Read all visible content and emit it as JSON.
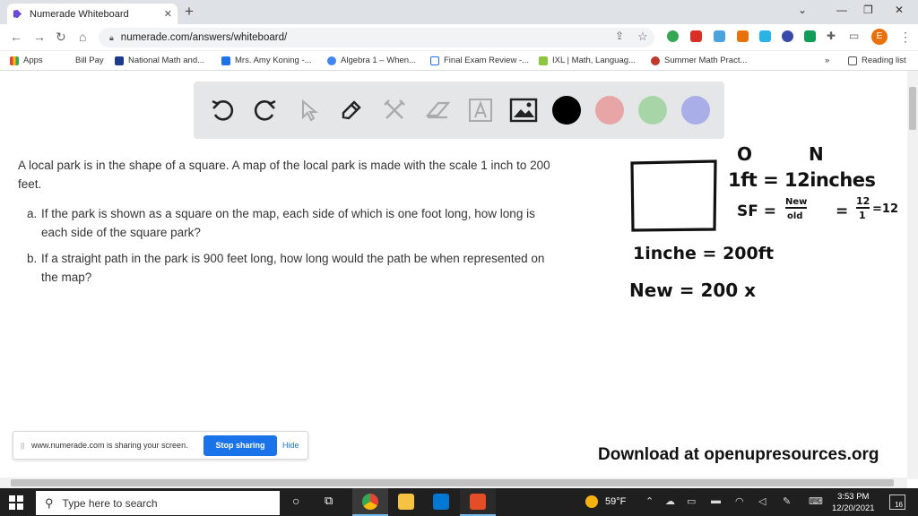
{
  "browser": {
    "tab_title": "Numerade Whiteboard",
    "url": "numerade.com/answers/whiteboard/",
    "profile_initial": "E"
  },
  "bookmarks": [
    {
      "label": "Apps"
    },
    {
      "label": "Bill Pay"
    },
    {
      "label": "National Math and..."
    },
    {
      "label": "Mrs. Amy Koning -..."
    },
    {
      "label": "Algebra 1 – When..."
    },
    {
      "label": "Final Exam Review -..."
    },
    {
      "label": "IXL | Math, Languag..."
    },
    {
      "label": "Summer Math Pract..."
    }
  ],
  "bookmarks_more": "»",
  "reading_list": "Reading list",
  "toolbar": {
    "tools": [
      "undo-icon",
      "redo-icon",
      "pointer-icon",
      "pen-icon",
      "tools-icon",
      "eraser-icon",
      "text-icon",
      "image-icon"
    ],
    "colors": [
      "#000000",
      "#e8a5a5",
      "#a8d5a8",
      "#a9aee8"
    ]
  },
  "question": {
    "intro": "A local park is in the shape of a square. A map of the local park is made with the scale 1 inch to 200 feet.",
    "parts": [
      {
        "label": "a.",
        "text": "If the park is shown as a square on the map, each side of which is one foot long, how long is each side of the square park?"
      },
      {
        "label": "b.",
        "text": "If a straight path in the park is 900 feet long, how long would the path be when represented on the map?"
      }
    ]
  },
  "handwriting": {
    "o_label": "O",
    "n_label": "N",
    "line1": "1ft = 12inches",
    "sf": "SF =",
    "frac_num": "New",
    "frac_den": "old",
    "eq": "=",
    "frac2_num": "12",
    "frac2_den": "1",
    "eq2": "=12",
    "line3": "1inche = 200ft",
    "line4": "New = 200 x"
  },
  "download_text": "Download at openupresources.org",
  "sharing": {
    "message": "www.numerade.com is sharing your screen.",
    "stop_label": "Stop sharing",
    "hide_label": "Hide"
  },
  "taskbar": {
    "search_placeholder": "Type here to search",
    "temperature": "59°F",
    "time": "3:53 PM",
    "date": "12/20/2021",
    "notifications": "16"
  }
}
